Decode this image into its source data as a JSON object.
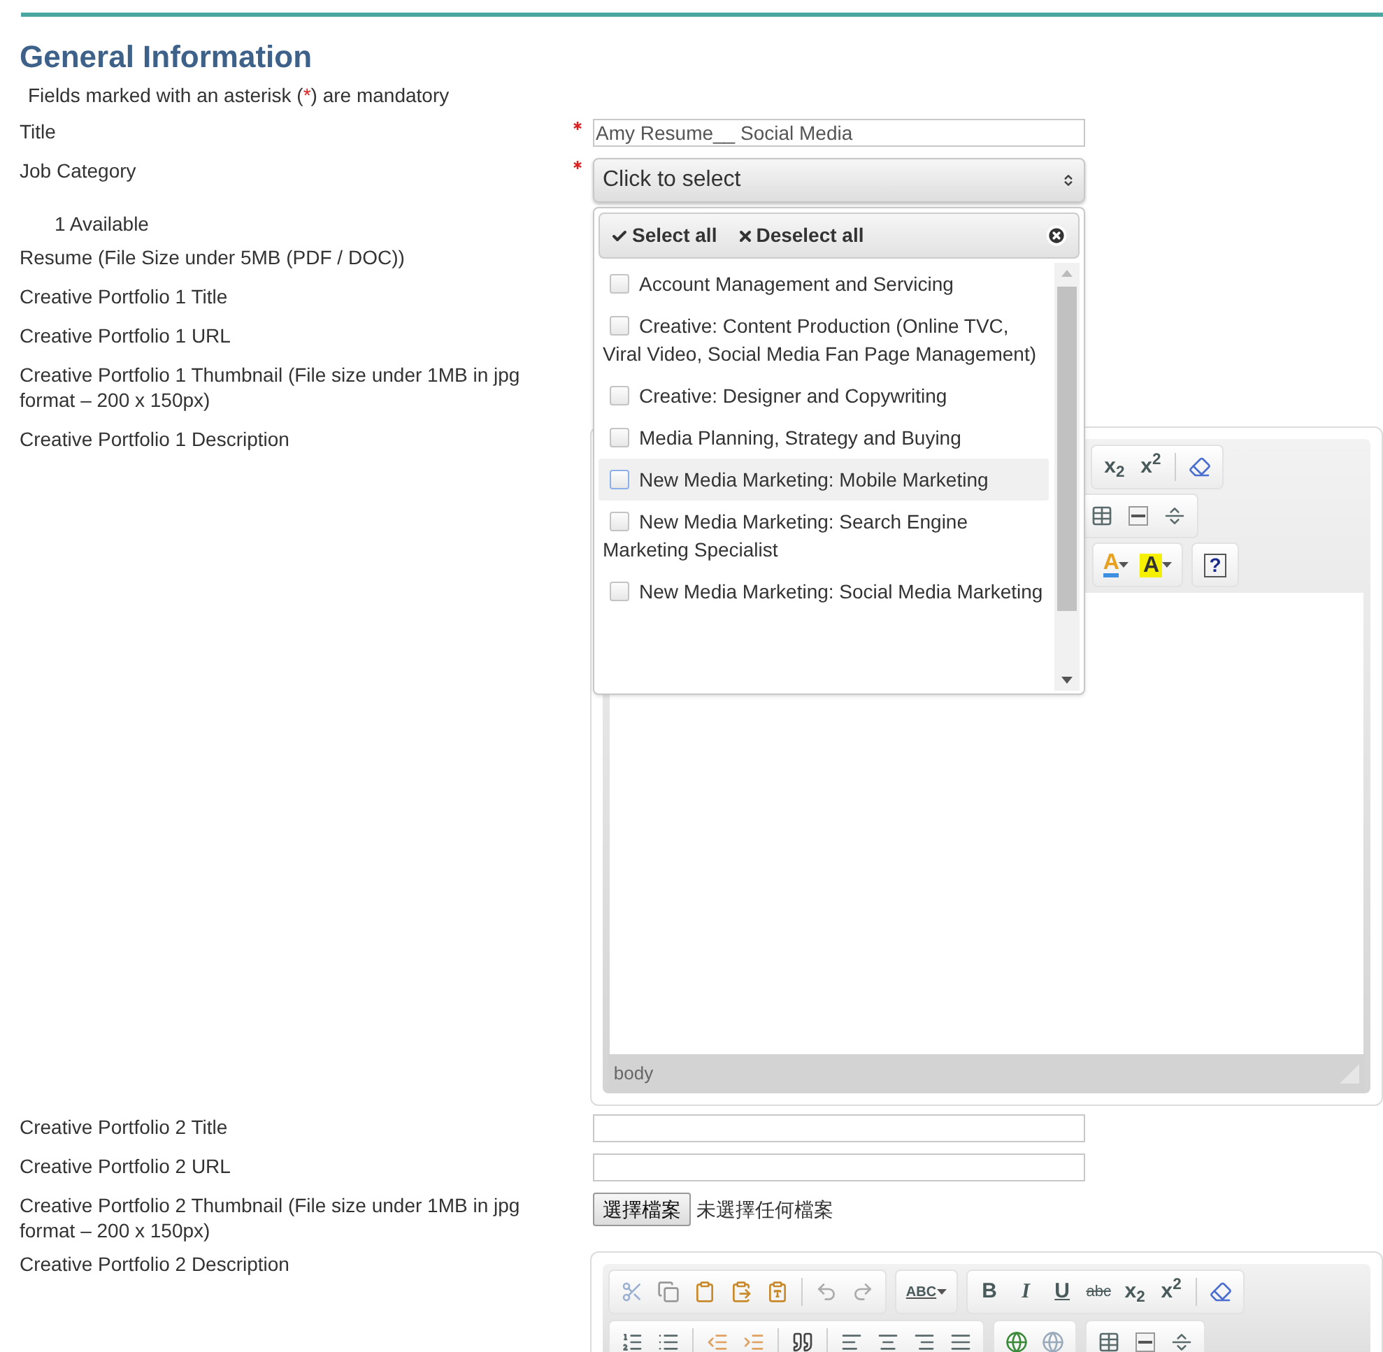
{
  "header": {
    "title": "General Information",
    "note": [
      "Fields marked with an asterisk (",
      "*",
      ") are mandatory"
    ]
  },
  "rows": [
    {
      "kind": "field",
      "label": "Title",
      "required": true,
      "control": {
        "kind": "text",
        "value": "Amy Resume__ Social Media"
      }
    },
    {
      "kind": "field",
      "label": "Job Category",
      "required": true,
      "control": {
        "kind": "multiselect",
        "text": "Click to select",
        "expanded": true,
        "menu": {
          "select_all": "Select all",
          "deselect_all": "Deselect all",
          "options": [
            {
              "label": "Account Management and Servicing",
              "checked": false,
              "highlighted": false
            },
            {
              "label": "Creative: Content Production (Online TVC, Viral Video, Social Media Fan Page Management)",
              "checked": false,
              "highlighted": false
            },
            {
              "label": "Creative: Designer and Copywriting",
              "checked": false,
              "highlighted": false
            },
            {
              "label": "Media Planning, Strategy and Buying",
              "checked": false,
              "highlighted": false
            },
            {
              "label": "New Media Marketing: Mobile Marketing",
              "checked": false,
              "highlighted": true
            },
            {
              "label": "New Media Marketing: Search Engine Marketing Specialist",
              "checked": false,
              "highlighted": false
            },
            {
              "label": "New Media Marketing: Social Media Marketing",
              "checked": false,
              "highlighted": false
            }
          ]
        }
      }
    },
    {
      "kind": "note",
      "label": "1 Available"
    },
    {
      "kind": "field",
      "label": "Resume (File Size under 5MB (PDF / DOC))",
      "required": false
    },
    {
      "kind": "field",
      "label": "Creative Portfolio 1 Title",
      "required": false
    },
    {
      "kind": "field",
      "label": "Creative Portfolio 1 URL",
      "required": false
    },
    {
      "kind": "field",
      "label": "Creative Portfolio 1 Thumbnail (File size under 1MB in jpg format – 200 x 150px)",
      "required": false
    },
    {
      "kind": "field",
      "label": "Creative Portfolio 1 Description",
      "required": false,
      "control": {
        "kind": "editor",
        "partly_hidden": true,
        "toolbar_texts": [
          "x$_{2}$",
          "x$^{2}$",
          "A",
          "A",
          "?"
        ],
        "status": "body"
      }
    },
    {
      "kind": "field",
      "label": "Creative Portfolio 2 Title",
      "required": false,
      "control": {
        "kind": "text"
      }
    },
    {
      "kind": "field",
      "label": "Creative Portfolio 2 URL",
      "required": false,
      "control": {
        "kind": "text"
      }
    },
    {
      "kind": "field",
      "label": "Creative Portfolio 2 Thumbnail (File size under 1MB in jpg format – 200 x 150px)",
      "required": false,
      "control": {
        "kind": "file",
        "button": "選擇檔案",
        "status": "未選擇任何檔案"
      }
    },
    {
      "kind": "field",
      "label": "Creative Portfolio 2 Description",
      "required": false,
      "control": {
        "kind": "editor",
        "partly_hidden": false,
        "toolbar_texts": [
          "ABC",
          "B",
          "I",
          "U",
          "abc",
          "x$_{2}$",
          "x$^{2}$"
        ]
      }
    }
  ]
}
